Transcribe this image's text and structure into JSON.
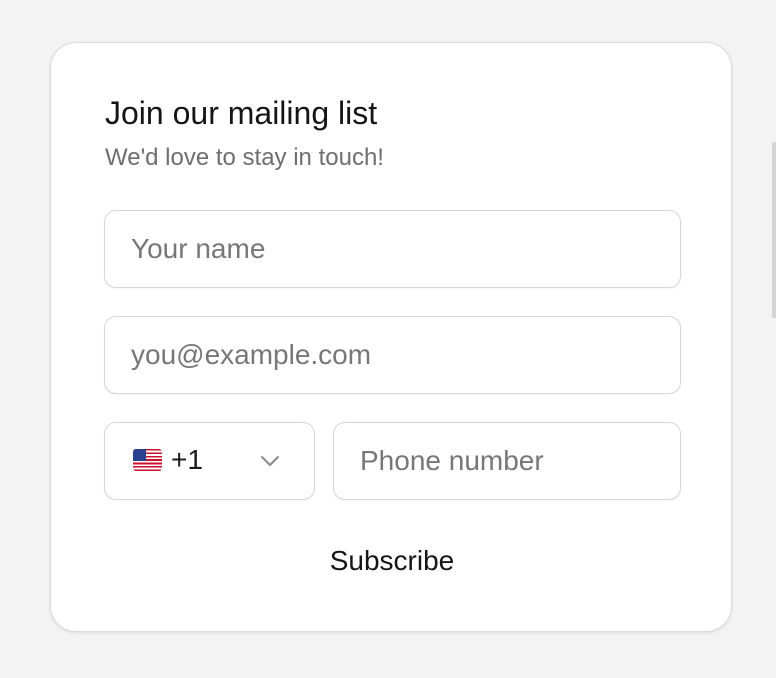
{
  "form": {
    "title": "Join our mailing list",
    "subtitle": "We'd love to stay in touch!",
    "name_placeholder": "Your name",
    "email_placeholder": "you@example.com",
    "country": {
      "flag": "us-flag-icon",
      "dial_code": "+1"
    },
    "phone_placeholder": "Phone number",
    "submit_label": "Subscribe"
  },
  "colors": {
    "background": "#f3f3f3",
    "card": "#ffffff",
    "border": "#d7d7d7",
    "text": "#151515",
    "muted": "#6e6e6e",
    "placeholder": "#777777"
  }
}
